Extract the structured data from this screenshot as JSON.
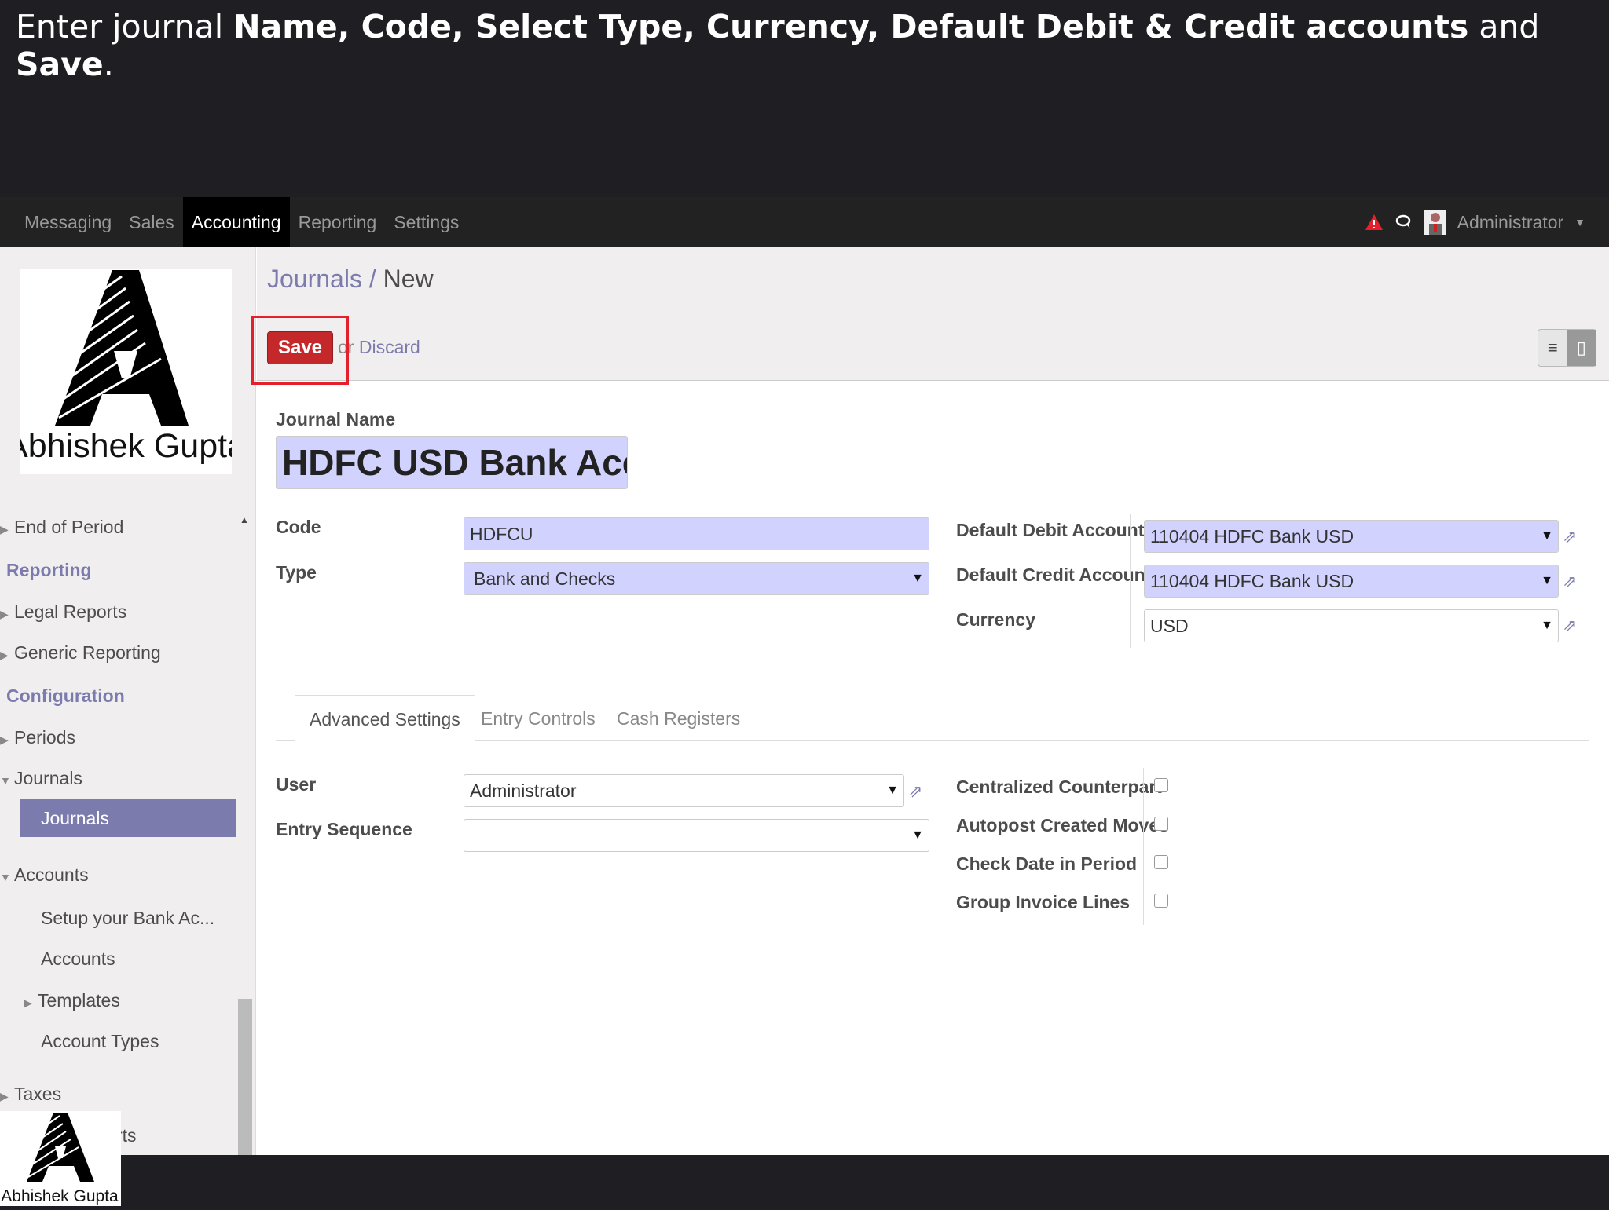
{
  "banner": {
    "t1": "Enter journal ",
    "b1": "Name, Code, Select Type, Currency, Default Debit & Credit accounts",
    "t2": " and ",
    "b2": "Save",
    "t3": "."
  },
  "topnav": {
    "menu": [
      "Messaging",
      "Sales",
      "Accounting",
      "Reporting",
      "Settings"
    ],
    "user": "Administrator"
  },
  "logo": {
    "text": "Abhishek Gupta"
  },
  "sidebar": {
    "end_of_period": "End of Period",
    "reporting_head": "Reporting",
    "legal_reports": "Legal Reports",
    "generic_reporting": "Generic Reporting",
    "configuration_head": "Configuration",
    "periods": "Periods",
    "journals_group": "Journals",
    "journals_item": "Journals",
    "accounts_group": "Accounts",
    "setup_bank": "Setup your Bank Ac...",
    "accounts_item": "Accounts",
    "templates": "Templates",
    "account_types": "Account Types",
    "taxes": "Taxes",
    "partial": "rts"
  },
  "breadcrumb": {
    "parent": "Journals",
    "sep": " / ",
    "current": "New"
  },
  "actions": {
    "save": "Save",
    "or": "or ",
    "discard": "Discard"
  },
  "form": {
    "journal_name_label": "Journal Name",
    "journal_name_value": "HDFC USD Bank Accou",
    "code_label": "Code",
    "code_value": "HDFCU",
    "type_label": "Type",
    "type_value": "Bank and Checks",
    "debit_label": "Default Debit Account",
    "debit_value": "110404 HDFC Bank USD",
    "credit_label": "Default Credit Account",
    "credit_value": "110404 HDFC Bank USD",
    "currency_label": "Currency",
    "currency_value": "USD"
  },
  "tabs": [
    "Advanced Settings",
    "Entry Controls",
    "Cash Registers"
  ],
  "advanced": {
    "user_label": "User",
    "user_value": "Administrator",
    "sequence_label": "Entry Sequence",
    "sequence_value": "",
    "centralized": "Centralized Counterpart",
    "autopost": "Autopost Created Moves",
    "check_date": "Check Date in Period",
    "group_invoice": "Group Invoice Lines"
  },
  "colors": {
    "accent": "#7c7bad",
    "save": "#c5282b",
    "required": "#d2d2ff"
  }
}
